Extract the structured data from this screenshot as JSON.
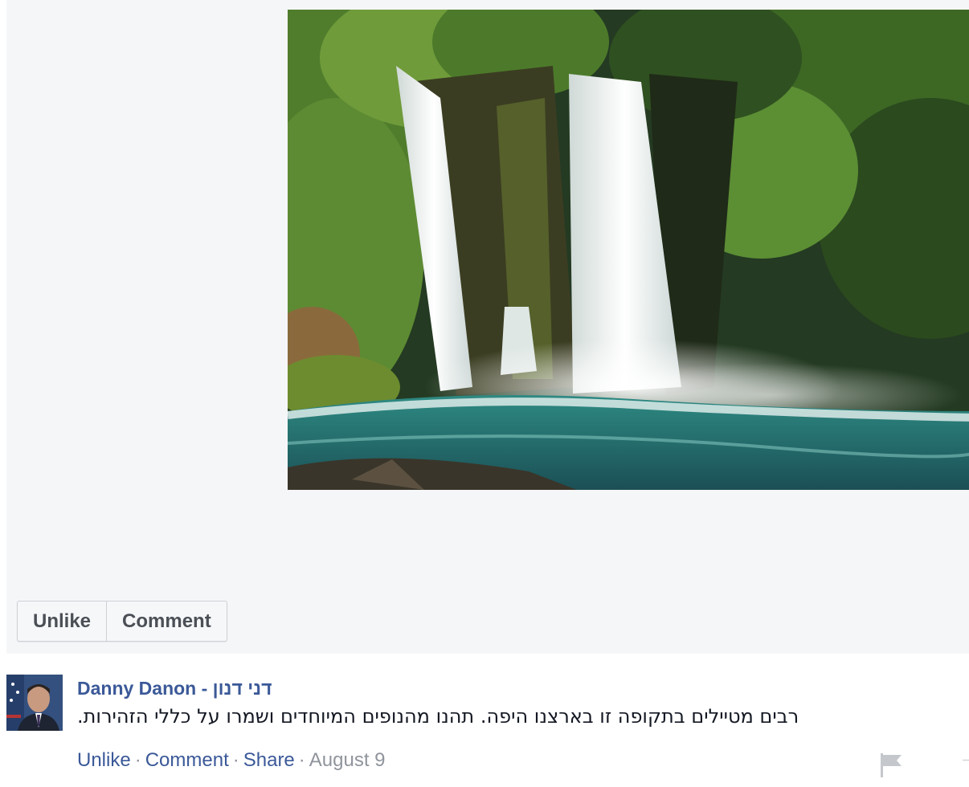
{
  "photo": {
    "description_icon": "waterfall-photo"
  },
  "actions_bar": {
    "unlike_label": "Unlike",
    "comment_label": "Comment"
  },
  "comment": {
    "author": "Danny Danon - דני דנון",
    "text": "רבים מטיילים בתקופה זו בארצנו היפה. תהנו מהנופים המיוחדים ושמרו על כללי הזהירות.",
    "links": {
      "unlike": "Unlike",
      "comment": "Comment",
      "share": "Share"
    },
    "separator": "·",
    "date": "August 9",
    "flag_icon": "flag-icon"
  },
  "colors": {
    "link_blue": "#3b5998",
    "meta_gray": "#90949c",
    "panel_bg": "#f5f6f8"
  }
}
